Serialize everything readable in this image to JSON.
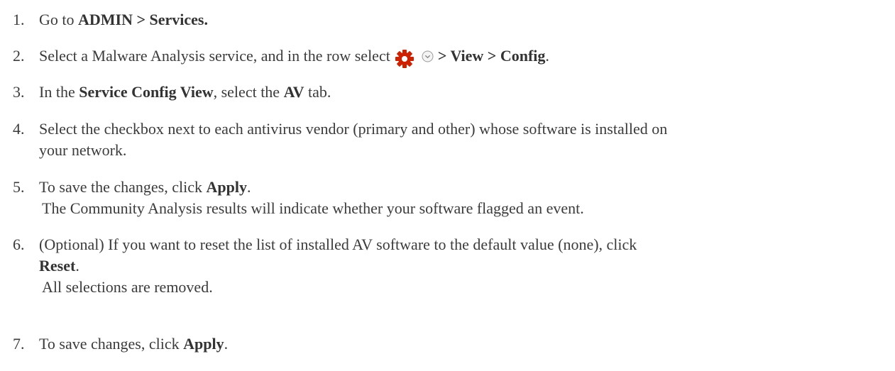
{
  "steps": [
    {
      "number": "1.",
      "text_before": "Go to ",
      "bold": "ADMIN > Services.",
      "text_after": ""
    },
    {
      "number": "2.",
      "text_before": "Select a Malware Analysis service, and in the row select",
      "bold": "> View > Config",
      "text_after": ".",
      "icons": [
        "gear-icon",
        "chevron-down-circle-icon"
      ],
      "icon_color": "#cc2200"
    },
    {
      "number": "3.",
      "text_before": "In the ",
      "bold": "Service Config View",
      "text_middle": ", select the ",
      "bold2": "AV",
      "text_after": " tab."
    },
    {
      "number": "4.",
      "line1": "Select the checkbox next to each antivirus vendor (primary and other) whose software is installed on",
      "line2": "your network."
    },
    {
      "number": "5.",
      "text_before": "To save the changes, click ",
      "bold": "Apply",
      "text_after": ".",
      "result": "The Community Analysis results will indicate whether your software flagged an event."
    },
    {
      "number": "6.",
      "line1": "(Optional) If you want to reset the list of installed AV software to the default value (none), click",
      "bold": "Reset",
      "text_after": ".",
      "result": "All selections are removed."
    },
    {
      "number": "7.",
      "text_before": "To save changes, click ",
      "bold": "Apply",
      "text_after": "."
    }
  ]
}
